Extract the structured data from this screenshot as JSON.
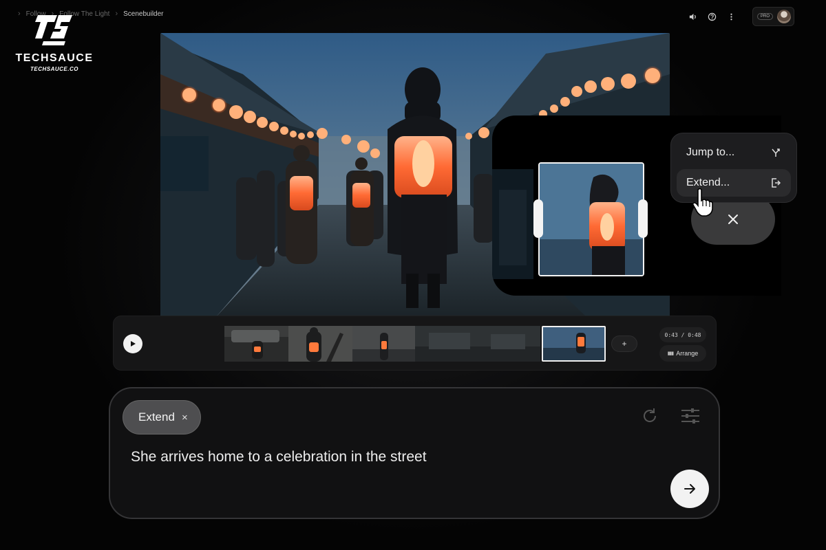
{
  "brand": {
    "name": "TECHSAUCE",
    "site": "TECHSAUCE.CO"
  },
  "breadcrumb": {
    "items": [
      "Follow",
      "Follow The Light",
      "Scenebuilder"
    ]
  },
  "topbar": {
    "icons": [
      "speaker-icon",
      "help-icon",
      "more-vert-icon"
    ],
    "plan_badge": "PRO"
  },
  "timeline": {
    "time_readout": "0:43 / 0:48",
    "arrange_label": "Arrange",
    "add_label": "+"
  },
  "context_menu": {
    "items": [
      {
        "label": "Jump to...",
        "icon": "jump-icon"
      },
      {
        "label": "Extend...",
        "icon": "extend-icon"
      }
    ]
  },
  "prompt": {
    "chip_label": "Extend",
    "chip_close": "×",
    "text": "She arrives home to a celebration in the street"
  },
  "colors": {
    "background": "#050505",
    "panel": "#161617",
    "accent_lantern": "#ff7a3c",
    "chip": "#4e4e50"
  }
}
